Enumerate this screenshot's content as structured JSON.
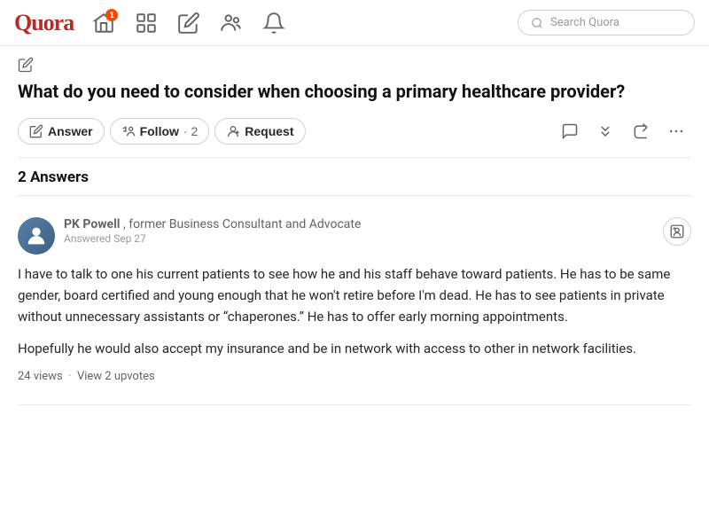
{
  "logo": "Quora",
  "nav": {
    "home_notification": "1",
    "search_placeholder": "Search Quora"
  },
  "question": {
    "title": "What do you need to consider when choosing a primary healthcare provider?",
    "actions": {
      "answer_label": "Answer",
      "follow_label": "Follow",
      "follow_count": "2",
      "request_label": "Request"
    },
    "answers_count_label": "2 Answers"
  },
  "answer": {
    "author_name": "PK Powell",
    "author_credentials": "former Business Consultant and Advocate",
    "date": "Answered Sep 27",
    "body_paragraph1": "I have to talk to one his current patients to see how he and his staff behave toward patients. He has to be same gender, board certified and young enough that he won't retire before I'm dead. He has to see patients in private without unnecessary assistants or “chaperones.” He has to offer early morning appointments.",
    "body_paragraph2": "Hopefully he would also accept my insurance and be in network with access to other in network facilities.",
    "views_label": "24 views",
    "upvotes_label": "View 2 upvotes"
  }
}
